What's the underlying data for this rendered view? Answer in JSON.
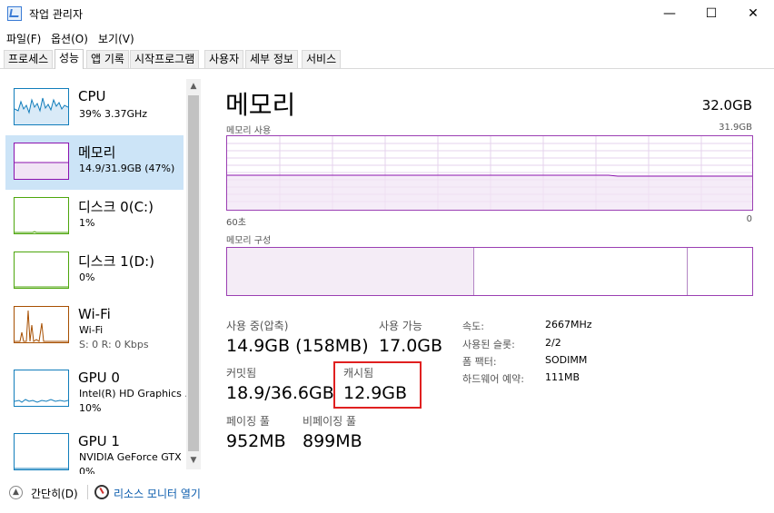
{
  "window": {
    "title": "작업 관리자",
    "minimize": "—",
    "maximize": "☐",
    "close": "✕"
  },
  "menu": [
    "파일(F)",
    "옵션(O)",
    "보기(V)"
  ],
  "tabs": [
    "프로세스",
    "성능",
    "앱 기록",
    "시작프로그램",
    "사용자",
    "세부 정보",
    "서비스"
  ],
  "active_tab": "성능",
  "sidebar": [
    {
      "name": "CPU",
      "line1": "39% 3.37GHz",
      "line2": "",
      "color": "#117dbb"
    },
    {
      "name": "메모리",
      "line1": "14.9/31.9GB (47%)",
      "line2": "",
      "color": "#8b12ae"
    },
    {
      "name": "디스크 0(C:)",
      "line1": "1%",
      "line2": "",
      "color": "#4da60c"
    },
    {
      "name": "디스크 1(D:)",
      "line1": "0%",
      "line2": "",
      "color": "#4da60c"
    },
    {
      "name": "Wi-Fi",
      "line1": "Wi-Fi",
      "line2": "S: 0 R: 0 Kbps",
      "color": "#a74f01"
    },
    {
      "name": "GPU 0",
      "line1": "Intel(R) HD Graphics .",
      "line2": "10%",
      "color": "#117dbb"
    },
    {
      "name": "GPU 1",
      "line1": "NVIDIA GeForce GTX",
      "line2": "0%",
      "color": "#117dbb"
    }
  ],
  "main": {
    "title": "메모리",
    "total": "32.0GB",
    "usage_label": "메모리 사용",
    "usage_max": "31.9GB",
    "time_left": "60초",
    "time_right": "0",
    "composition_label": "메모리 구성",
    "usage_level": 0.47
  },
  "stats": {
    "in_use_label": "사용 중(압축)",
    "in_use_value": "14.9GB (158MB)",
    "available_label": "사용 가능",
    "available_value": "17.0GB",
    "committed_label": "커밋됨",
    "committed_value": "18.9/36.6GB",
    "cached_label": "캐시됨",
    "cached_value": "12.9GB",
    "paged_label": "페이징 풀",
    "paged_value": "952MB",
    "nonpaged_label": "비페이징 풀",
    "nonpaged_value": "899MB"
  },
  "specs": [
    {
      "label": "속도:",
      "value": "2667MHz"
    },
    {
      "label": "사용된 슬롯:",
      "value": "2/2"
    },
    {
      "label": "폼 팩터:",
      "value": "SODIMM"
    },
    {
      "label": "하드웨어 예약:",
      "value": "111MB"
    }
  ],
  "footer": {
    "collapse": "간단히(D)",
    "monitor": "리소스 모니터 열기"
  }
}
